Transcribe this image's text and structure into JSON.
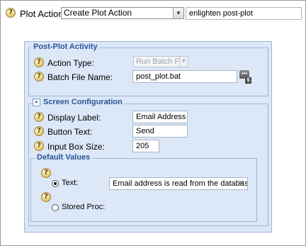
{
  "plot_action": {
    "label": "Plot Action:",
    "selected": "Create Plot Action",
    "name_value": "enlighten post-plot"
  },
  "post_plot": {
    "legend": "Post-Plot Activity",
    "action_type_label": "Action Type:",
    "action_type_value": "Run Batch File",
    "batch_label": "Batch File Name:",
    "batch_value": "post_plot.bat",
    "browse_badge": "$"
  },
  "screen_config": {
    "legend": "Screen Configuration",
    "display_label": "Display Label:",
    "display_value": "Email Address",
    "button_text_label": "Button Text:",
    "button_text_value": "Send",
    "input_size_label": "Input Box Size:",
    "input_size_value": "205"
  },
  "default_values": {
    "legend": "Default Values",
    "text_label": "Text:",
    "text_value": "Email address is read from the database",
    "text_selected": true,
    "stored_proc_label": "Stored Proc:"
  },
  "icons": {
    "help": "help-icon",
    "dropdown": "chevron-down-icon",
    "collapse": "collapse-up-icon",
    "browse": "browse-icon",
    "clear": "clear-icon"
  },
  "colors": {
    "panel_bg": "#dce7f7",
    "legend_text": "#2a5599",
    "border": "#9fb6d9"
  }
}
